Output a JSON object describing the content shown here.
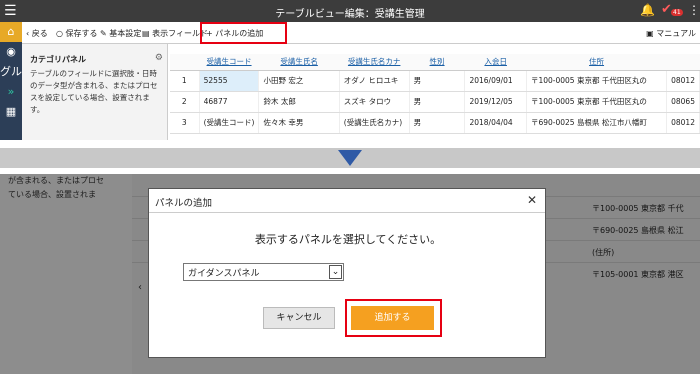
{
  "app": {
    "title": "テーブルビュー編集：受講生管理",
    "menu_icon": "hamburger-icon",
    "badge_count": "41"
  },
  "toolbar": {
    "back_label": "戻る",
    "save_label": "保存する",
    "basic_settings_label": "基本設定",
    "display_fields_label": "表示フィールド",
    "add_panel_label": "パネルの追加",
    "manual_label": "マニュアル"
  },
  "leftnav": {
    "items": [
      "home-icon",
      "database-icon",
      "グル",
      "chevron-right-icon",
      "calendar-icon"
    ]
  },
  "category_panel": {
    "title": "カテゴリパネル",
    "description": "テーブルのフィールドに選択肢・日時のデータ型が含まれる、またはプロセスを設定している場合、設置されます。"
  },
  "table": {
    "headers": [
      "受講生コード",
      "受講生氏名",
      "受講生氏名カナ",
      "性別",
      "入会日",
      "住所"
    ],
    "rows": [
      {
        "no": "1",
        "code": "52555",
        "name": "小田野 宏之",
        "kana": "オダノ ヒロユキ",
        "gender": "男",
        "date": "2016/09/01",
        "address": "〒100-0005 東京都 千代田区丸の",
        "extra": "08012"
      },
      {
        "no": "2",
        "code": "46877",
        "name": "鈴木 太郎",
        "kana": "スズキ タロウ",
        "gender": "男",
        "date": "2019/12/05",
        "address": "〒100-0005 東京都 千代田区丸の",
        "extra": "08065"
      },
      {
        "no": "3",
        "code": "(受講生コード)",
        "name": "佐々木 幸男",
        "kana": "(受講生氏名カナ)",
        "gender": "男",
        "date": "2018/04/04",
        "address": "〒690-0025 島根県 松江市八幡町",
        "extra": "08012"
      }
    ]
  },
  "background": {
    "text_lines": [
      "が含まれる、またはプロセ",
      "ている場合、設置されま"
    ],
    "addresses": [
      "〒100-0005 東京都 千代",
      "〒690-0025 島根県 松江",
      "(住所)",
      "〒105-0001 東京都 港区"
    ],
    "left_chevron": "‹"
  },
  "modal": {
    "title": "パネルの追加",
    "message": "表示するパネルを選択してください。",
    "select_value": "ガイダンスパネル",
    "cancel_label": "キャンセル",
    "add_label": "追加する"
  },
  "colors": {
    "appbar": "#3c3c3c",
    "leftnav": "#2c3e57",
    "highlight": "#e60012",
    "accent_button": "#f5a020",
    "arrow": "#2f5aa6"
  }
}
